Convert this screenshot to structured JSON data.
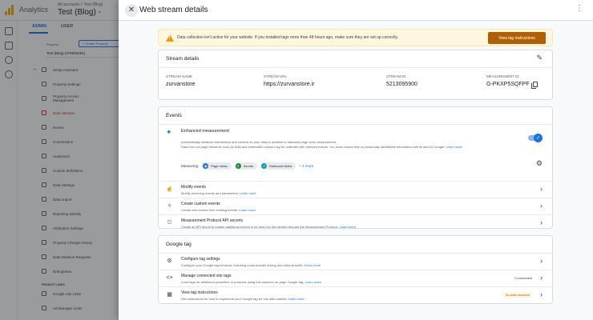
{
  "app": {
    "name": "Analytics",
    "account_path": "All accounts > Test (Blog)",
    "account_name": "Test (Blog) -"
  },
  "admin": {
    "tabs": [
      "ADMIN",
      "USER"
    ],
    "property_label": "Property",
    "create_property": "+ Create Property",
    "property_selected": "Test (Blog) (376055281)",
    "nav": [
      "Setup Assistant",
      "Property Settings",
      "Property Access Management",
      "Data Streams",
      "Events",
      "Conversions",
      "Audiences",
      "Custom definitions",
      "Data Settings",
      "Data Import",
      "Reporting Identity",
      "Attribution Settings",
      "Property Change History",
      "Data Deletion Requests",
      "DebugView"
    ],
    "section_product_links": "PRODUCT LINKS",
    "links": [
      "Google Ads Links",
      "Ad Manager Links"
    ]
  },
  "panel": {
    "title": "Web stream details",
    "warning": {
      "text": "Data collection isn't active for your website. If you installed tags more than 48 hours ago, make sure they are set up correctly.",
      "button": "View tag instructions"
    },
    "stream_details": {
      "title": "Stream details",
      "fields": [
        {
          "label": "STREAM NAME",
          "value": "zurvanstore"
        },
        {
          "label": "STREAM URL",
          "value": "https://zurvanstore.ir"
        },
        {
          "label": "STREAM ID",
          "value": "5213095900"
        },
        {
          "label": "MEASUREMENT ID",
          "value": "G-PKXP5SQFPF"
        }
      ]
    },
    "events": {
      "title": "Events",
      "enhanced": {
        "title": "Enhanced measurement",
        "desc1": "Automatically measure interactions and content on your sites in addition to standard page view measurement.",
        "desc2": "Data from on-page elements such as links and embedded videos may be collected with relevant events. You must ensure that no personally-identifiable information will be sent to Google.",
        "learn_more": "Learn more",
        "measuring_label": "Measuring:",
        "chips": [
          "Page views",
          "Scrolls",
          "Outbound clicks"
        ],
        "more": "+ 4 more"
      },
      "rows": [
        {
          "title": "Modify events",
          "desc": "Modify incoming events and parameters.",
          "link": "Learn more"
        },
        {
          "title": "Create custom events",
          "desc": "Create new events from existing events.",
          "link": "Learn more"
        },
        {
          "title": "Measurement Protocol API secrets",
          "desc": "Create an API secret to enable additional events to be sent into this stream through the Measurement Protocol.",
          "link": "Learn more"
        }
      ]
    },
    "google_tag": {
      "title": "Google tag",
      "rows": [
        {
          "title": "Configure tag settings",
          "desc": "Configure your Google tag behavior, including cross-domain linking and internal traffic.",
          "link": "Learn more",
          "status": ""
        },
        {
          "title": "Manage connected site tags",
          "desc": "Load tags for additional properties or products using this stream's on-page Google tag.",
          "link": "Learn more",
          "status": "0 connected"
        },
        {
          "title": "View tag instructions",
          "desc": "Get instructions for how to implement your Google tag for this data stream.",
          "link": "Learn more",
          "status": "No data received"
        }
      ]
    }
  },
  "colors": {
    "primary": "#1a73e8",
    "warning_bg": "#fef7e0",
    "warning_button": "#b06000",
    "active_nav": "#d93025"
  }
}
